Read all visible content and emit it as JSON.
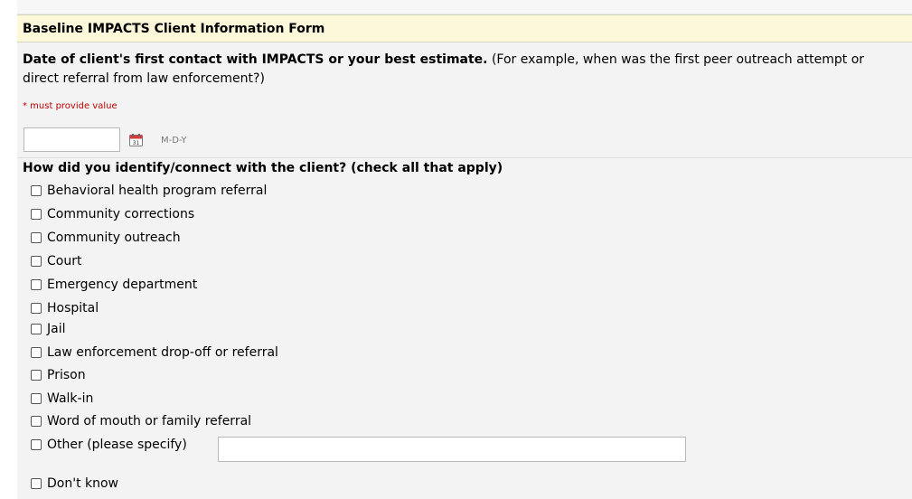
{
  "form": {
    "title": "Baseline IMPACTS Client Information Form"
  },
  "question1": {
    "title_bold": "Date of client's first contact with IMPACTS or your best estimate.",
    "title_note": "(For example, when was the first peer outreach attempt or direct referral from law enforcement?)",
    "required_text": "* must provide value",
    "date_value": "",
    "date_format": "M-D-Y",
    "calendar_icon": "calendar-icon",
    "calendar_day": "31",
    "required_color": "#c00000"
  },
  "question2": {
    "title": "How did you identify/connect with the client? (check all that apply)",
    "options": [
      {
        "label": "Behavioral health program referral",
        "checked": false
      },
      {
        "label": "Community corrections",
        "checked": false
      },
      {
        "label": "Community outreach",
        "checked": false
      },
      {
        "label": "Court",
        "checked": false
      },
      {
        "label": "Emergency department",
        "checked": false
      },
      {
        "label": "Hospital",
        "checked": false
      },
      {
        "label": "Jail",
        "checked": false
      },
      {
        "label": "Law enforcement drop-off or referral",
        "checked": false
      },
      {
        "label": "Prison",
        "checked": false
      },
      {
        "label": "Walk-in",
        "checked": false
      },
      {
        "label": "Word of mouth or family referral",
        "checked": false
      },
      {
        "label": "Other (please specify)",
        "checked": false
      },
      {
        "label": "Don't know",
        "checked": false
      }
    ],
    "other_value": ""
  },
  "colors": {
    "header_bg": "#fcf8d9",
    "form_bg": "#f3f3f3"
  }
}
